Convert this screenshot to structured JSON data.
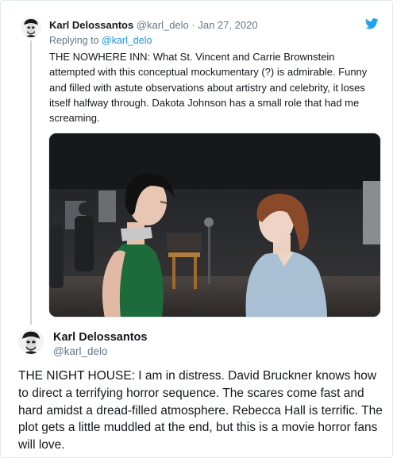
{
  "colors": {
    "text_primary": "#14171a",
    "text_secondary": "#657786",
    "link": "#1b95e0",
    "twitter_blue": "#1da1f2",
    "thread_line": "#ccd6dd"
  },
  "icons": {
    "brand": "twitter-bird-icon"
  },
  "parent_tweet": {
    "author_name": "Karl Delossantos",
    "author_handle": "@karl_delo",
    "separator": "·",
    "date": "Jan 27, 2020",
    "replying_to_prefix": "Replying to ",
    "replying_to_handle": "@karl_delo",
    "text": "THE NOWHERE INN: What St. Vincent and Carrie Brownstein attempted with this conceptual mockumentary (?) is admirable. Funny and filled with astute observations about artistry and celebrity, it loses itself halfway through. Dakota Johnson has a small role that had me screaming."
  },
  "main_tweet": {
    "author_name": "Karl Delossantos",
    "author_handle": "@karl_delo",
    "text": "THE NIGHT HOUSE: I am in distress. David Bruckner knows how to direct a terrifying horror sequence. The scares come fast and hard amidst a dread-filled atmosphere. Rebecca Hall is terrific. The plot gets a little muddled at the end, but this is a movie horror fans will love."
  }
}
